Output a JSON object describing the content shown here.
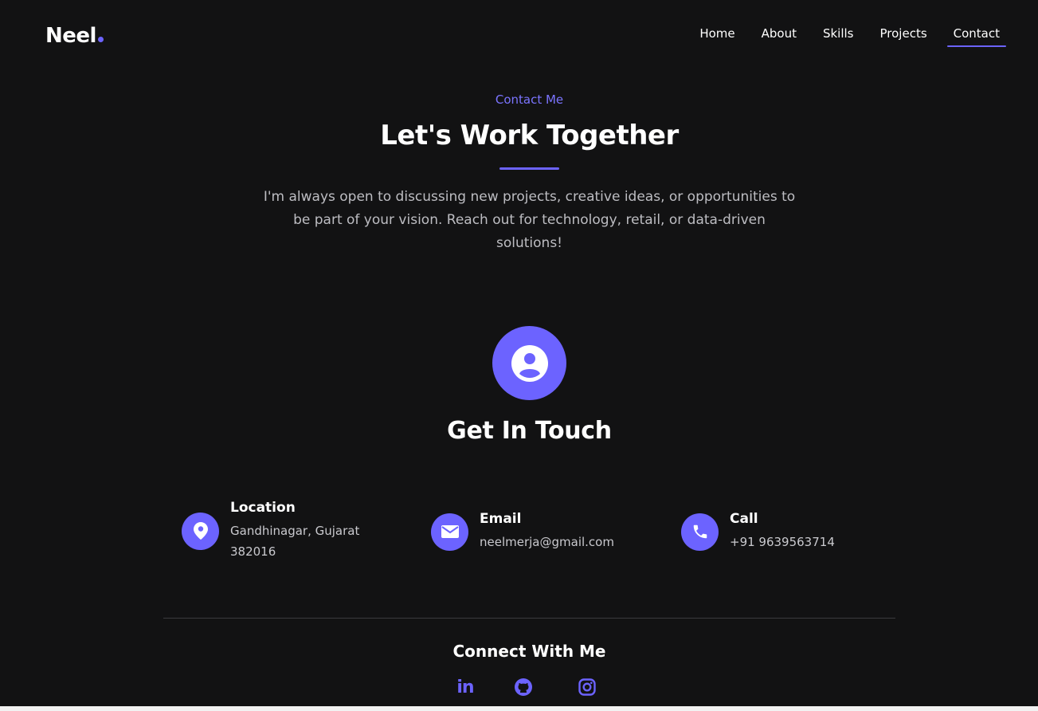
{
  "header": {
    "logo": "Neel",
    "nav": [
      {
        "label": "Home",
        "active": false
      },
      {
        "label": "About",
        "active": false
      },
      {
        "label": "Skills",
        "active": false
      },
      {
        "label": "Projects",
        "active": false
      },
      {
        "label": "Contact",
        "active": true
      }
    ]
  },
  "hero": {
    "eyebrow": "Contact Me",
    "title": "Let's Work Together",
    "intro": "I'm always open to discussing new projects, creative ideas, or opportunities to be part of your vision. Reach out for technology, retail, or data-driven solutions!"
  },
  "touch": {
    "title": "Get In Touch",
    "icon": "user-circle-icon",
    "items": [
      {
        "icon": "location-pin-icon",
        "label": "Location",
        "value": "Gandhinagar, Gujarat 382016"
      },
      {
        "icon": "envelope-icon",
        "label": "Email",
        "value": "neelmerja@gmail.com"
      },
      {
        "icon": "phone-icon",
        "label": "Call",
        "value": "+91 9639563714"
      }
    ]
  },
  "connect": {
    "title": "Connect With Me",
    "socials": [
      {
        "icon": "linkedin-icon",
        "text": "in"
      },
      {
        "icon": "github-icon"
      },
      {
        "icon": "instagram-icon"
      }
    ]
  },
  "colors": {
    "background": "#121213",
    "accent": "#6c63ff",
    "text": "#ffffff",
    "muted": "#bdbdc2"
  }
}
